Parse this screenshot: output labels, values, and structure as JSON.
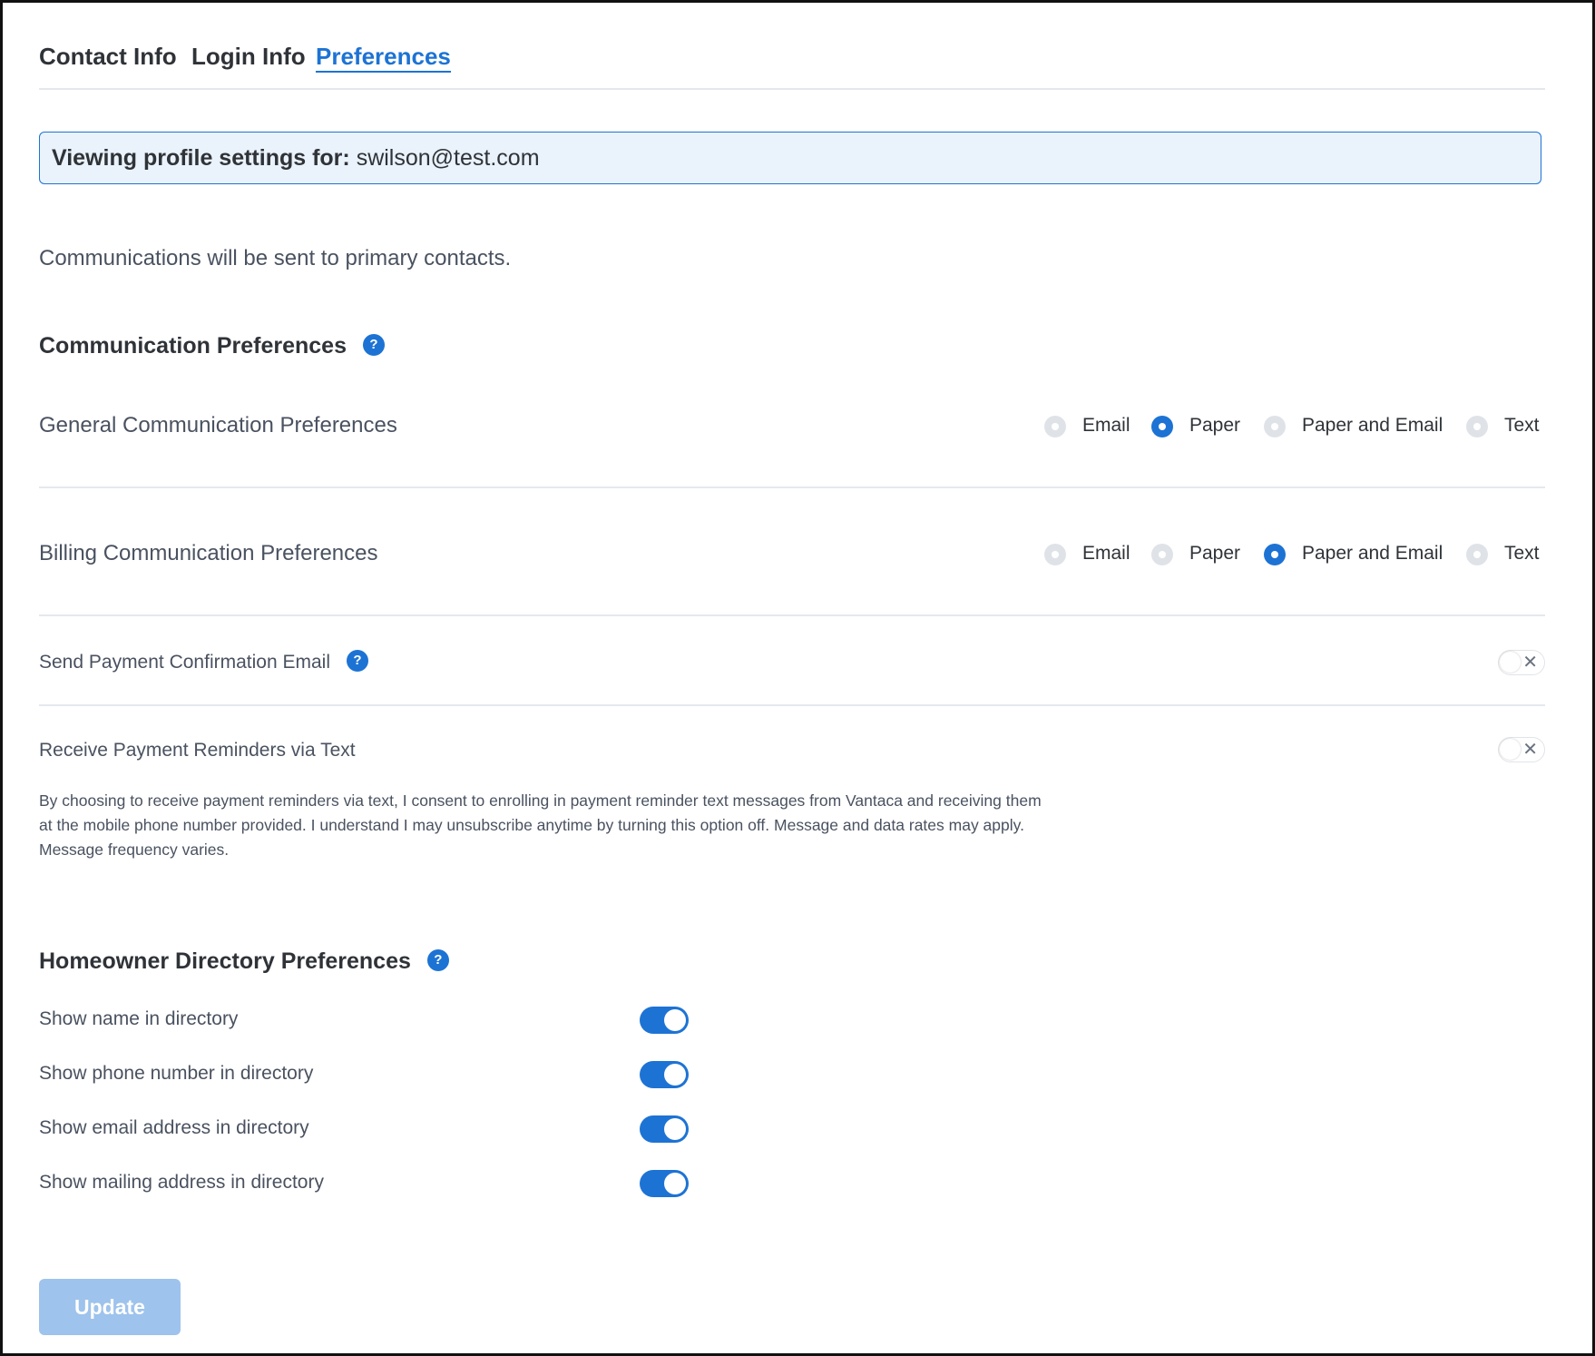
{
  "tabs": [
    {
      "label": "Contact Info",
      "active": false
    },
    {
      "label": "Login Info",
      "active": false
    },
    {
      "label": "Preferences",
      "active": true
    }
  ],
  "banner": {
    "prefix": "Viewing profile settings for:",
    "email": "swilson@test.com"
  },
  "intro": "Communications will be sent to primary contacts.",
  "communication": {
    "title": "Communication Preferences",
    "general": {
      "label": "General Communication Preferences",
      "options": [
        "Email",
        "Paper",
        "Paper and Email",
        "Text"
      ],
      "selected": "Paper"
    },
    "billing": {
      "label": "Billing Communication Preferences",
      "options": [
        "Email",
        "Paper",
        "Paper and Email",
        "Text"
      ],
      "selected": "Paper and Email"
    },
    "payment_confirmation": {
      "label": "Send Payment Confirmation Email",
      "enabled": false
    },
    "payment_reminders": {
      "label": "Receive Payment Reminders via Text",
      "enabled": false
    },
    "consent_text": "By choosing to receive payment reminders via text, I consent to enrolling in payment reminder text messages from Vantaca and receiving them at the mobile phone number provided. I understand I may unsubscribe anytime by turning this option off. Message and data rates may apply. Message frequency varies."
  },
  "directory": {
    "title": "Homeowner Directory Preferences",
    "items": [
      {
        "label": "Show name in directory",
        "enabled": true
      },
      {
        "label": "Show phone number in directory",
        "enabled": true
      },
      {
        "label": "Show email address in directory",
        "enabled": true
      },
      {
        "label": "Show mailing address in directory",
        "enabled": true
      }
    ]
  },
  "update_button": "Update",
  "colors": {
    "accent": "#1d73d4",
    "banner_bg": "#eaf2fb",
    "button_disabled": "#9ec3ec"
  },
  "icons": {
    "help": "question-circle-icon",
    "toggle_off": "close-icon"
  }
}
